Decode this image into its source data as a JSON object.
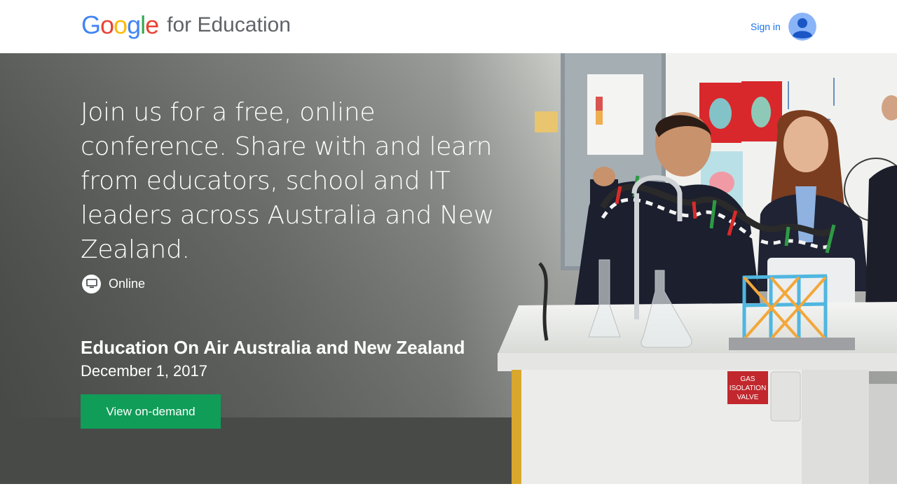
{
  "header": {
    "logo_google_letters": [
      "G",
      "o",
      "o",
      "g",
      "l",
      "e"
    ],
    "logo_product": "for Education",
    "signin_label": "Sign in"
  },
  "hero": {
    "headline": "Join us for a free, online conference. Share with and learn from educators, school and IT leaders across Australia and New Zealand.",
    "location_label": "Online",
    "event_title": "Education On Air Australia and New Zealand",
    "event_date": "December 1, 2017",
    "cta_label": "View on-demand",
    "lab_sign_text": "GAS ISOLATION VALVE"
  },
  "colors": {
    "google_blue": "#4285f4",
    "google_red": "#ea4335",
    "google_yellow": "#fbbc05",
    "google_green": "#34a853",
    "cta_green": "#0f9d58",
    "link_blue": "#1a73e8"
  },
  "icons": {
    "avatar": "account-avatar-icon",
    "location": "monitor-icon"
  }
}
